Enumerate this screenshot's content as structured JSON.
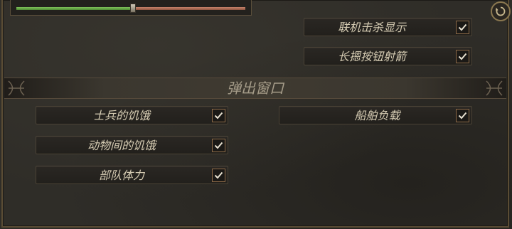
{
  "volume_slider": {
    "value_fraction": 0.51,
    "fill_color": "#7fc25a",
    "rest_color": "#c6836a"
  },
  "refresh": {
    "icon": "refresh-icon"
  },
  "top_options": [
    {
      "label": "联机击杀显示",
      "checked": true
    },
    {
      "label": "长摁按钮射箭",
      "checked": true
    }
  ],
  "section": {
    "title": "弹出窗口"
  },
  "popup_left": [
    {
      "label": "士兵的饥饿",
      "checked": true
    },
    {
      "label": "动物间的饥饿",
      "checked": true
    },
    {
      "label": "部队体力",
      "checked": true
    }
  ],
  "popup_right": [
    {
      "label": "船舶负载",
      "checked": true
    }
  ],
  "colors": {
    "accent": "#e08a55",
    "text": "#d7cdb4",
    "border": "#8c6a48"
  }
}
